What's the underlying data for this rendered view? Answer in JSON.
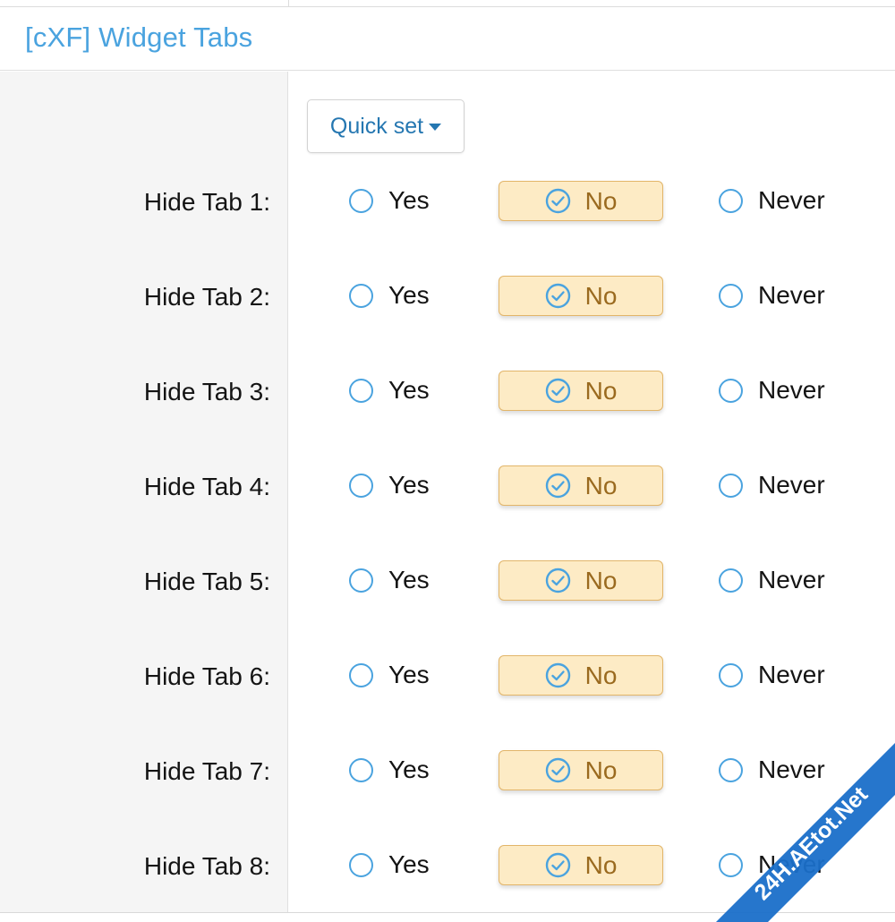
{
  "section": {
    "title": "[cXF] Widget Tabs"
  },
  "quick_set": {
    "label": "Quick set"
  },
  "options": [
    "Yes",
    "No",
    "Never"
  ],
  "selected_option": "No",
  "rows": [
    {
      "label": "Hide Tab 1:"
    },
    {
      "label": "Hide Tab 2:"
    },
    {
      "label": "Hide Tab 3:"
    },
    {
      "label": "Hide Tab 4:"
    },
    {
      "label": "Hide Tab 5:"
    },
    {
      "label": "Hide Tab 6:"
    },
    {
      "label": "Hide Tab 7:"
    },
    {
      "label": "Hide Tab 8:"
    }
  ],
  "watermark": {
    "text": "24H.AEtot.Net"
  },
  "colors": {
    "accent": "#4aa3df",
    "link": "#2577b1",
    "selected_bg": "#fdebc5",
    "selected_border": "#e2b569",
    "selected_text": "#9a6a1f",
    "watermark_band": "#1a6fc9"
  }
}
